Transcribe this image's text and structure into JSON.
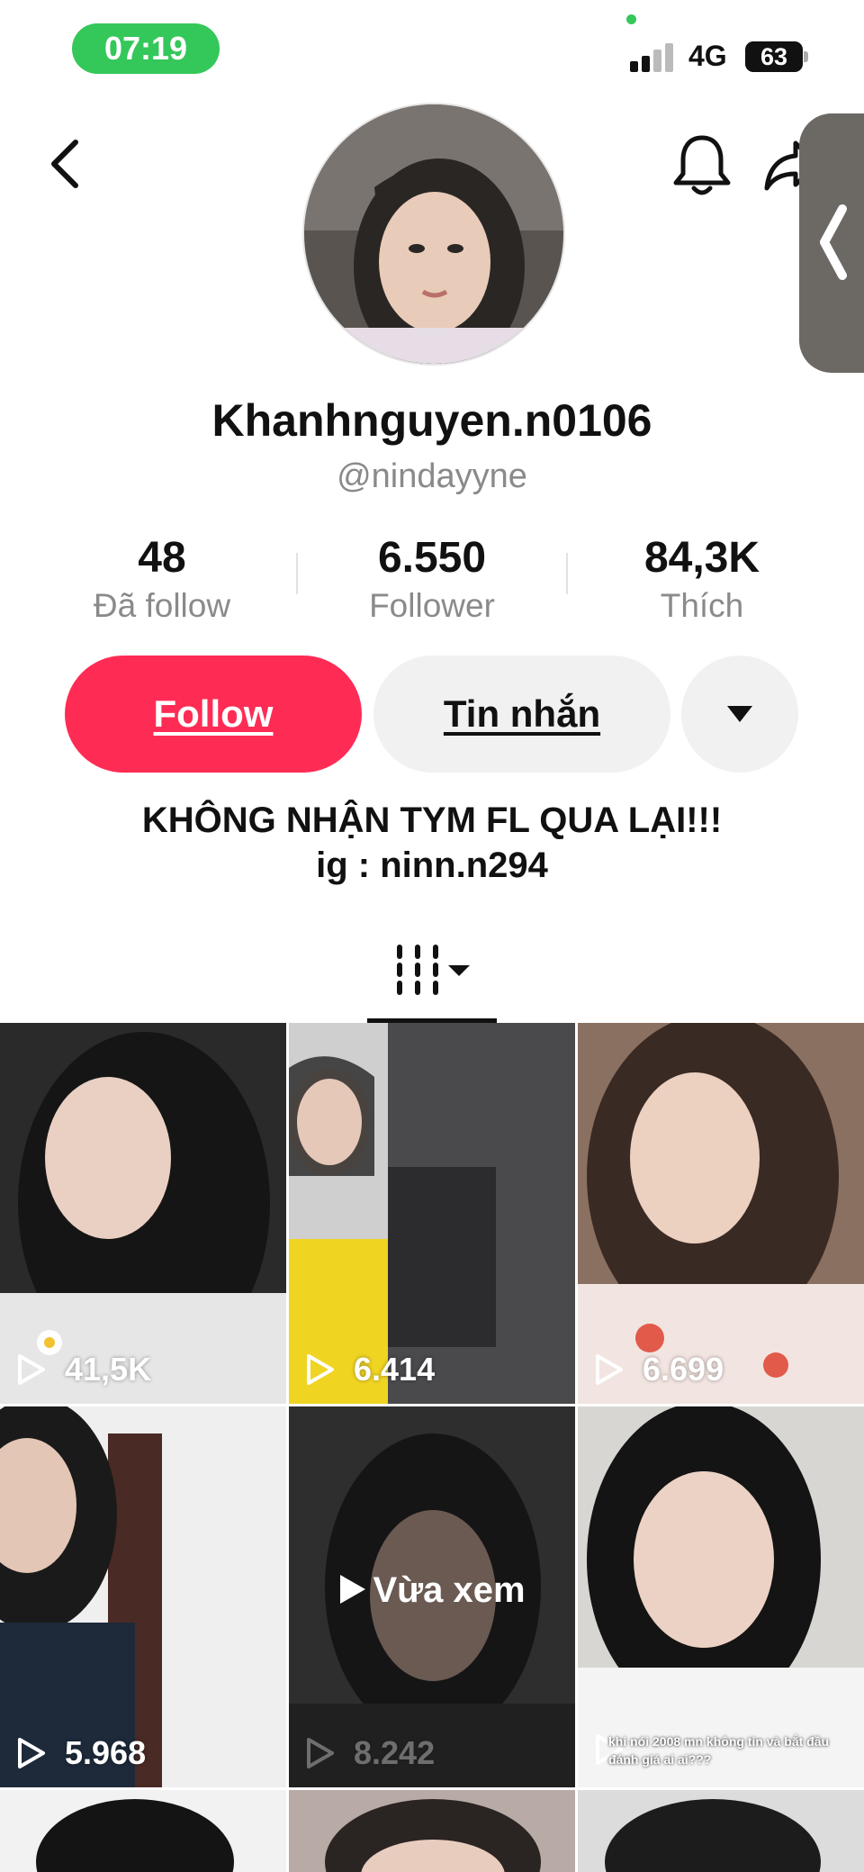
{
  "status_bar": {
    "time": "07:19",
    "network": "4G",
    "battery": "63"
  },
  "profile": {
    "display_name": "Khanhnguyen.n0106",
    "username": "@nindayyne",
    "bio_line1": "KHÔNG NHẬN TYM FL QUA LẠI!!!",
    "bio_line2": "ig : ninn.n294"
  },
  "stats": [
    {
      "value": "48",
      "label": "Đã follow"
    },
    {
      "value": "6.550",
      "label": "Follower"
    },
    {
      "value": "84,3K",
      "label": "Thích"
    }
  ],
  "actions": {
    "follow_label": "Follow",
    "message_label": "Tin nhắn"
  },
  "videos": [
    {
      "views": "41,5K"
    },
    {
      "views": "6.414"
    },
    {
      "views": "6.699"
    },
    {
      "views": "5.968"
    },
    {
      "views": "8.242",
      "overlay": "Vừa xem"
    },
    {
      "views": "",
      "caption": "khi nói 2008 mn không tin và bắt đầu đánh giá ai ai???"
    }
  ],
  "colors": {
    "follow_button": "#fe2c55",
    "time_pill": "#34c759"
  },
  "icons": [
    "back-arrow-icon",
    "bell-icon",
    "share-icon",
    "grid-icon",
    "chevron-down-icon",
    "play-icon"
  ]
}
